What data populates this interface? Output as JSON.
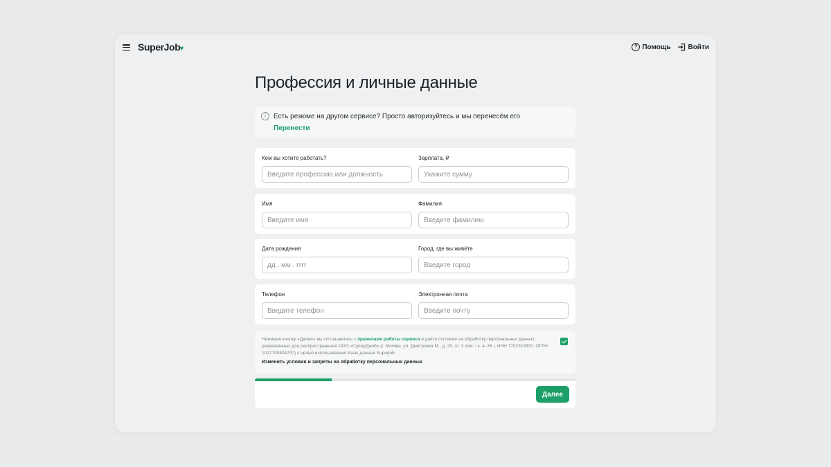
{
  "header": {
    "logo_text": "SuperJob",
    "help_label": "Помощь",
    "login_label": "Войти"
  },
  "page": {
    "title": "Профессия и личные данные"
  },
  "notice": {
    "message": "Есть резюме на другом сервисе? Просто авторизуйтесь и мы перенесём его",
    "link": "Перенести"
  },
  "form": {
    "profession": {
      "label": "Кем вы хотите работать?",
      "placeholder": "Введите профессию или должность",
      "value": ""
    },
    "salary": {
      "label": "Зарплата, ₽",
      "placeholder": "Укажите сумму",
      "value": ""
    },
    "first_name": {
      "label": "Имя",
      "placeholder": "Введите имя",
      "value": ""
    },
    "last_name": {
      "label": "Фамилия",
      "placeholder": "Введите фамилию",
      "value": ""
    },
    "birth_date": {
      "label": "Дата рождения",
      "placeholder": "дд . мм . гггг",
      "value": ""
    },
    "city": {
      "label": "Город, где вы живёте",
      "placeholder": "Введите город",
      "value": ""
    },
    "phone": {
      "label": "Телефон",
      "placeholder": "Введите телефон",
      "value": ""
    },
    "email": {
      "label": "Электронная почта",
      "placeholder": "Введите почту",
      "value": ""
    }
  },
  "consent": {
    "text_before": "Нажимая кнопку «Далее» вы соглашаетесь с ",
    "rules_link": "правилами работы сервиса",
    "text_after": " и даёте согласие на обработку персональных данных, разрешённых для распространения ООО «СуперДжоб» (г. Москва, ул. Дмитровка М., д. 20, эт. 3 пом. I к. 4–36 г, ИНН 7702319337, ОГРН 1027700404797) с целью использования Базы данных Superjob.",
    "change_link": "Изменить условия и запреты на обработку персональных данных",
    "checked": true
  },
  "progress": {
    "fraction": 0.24
  },
  "actions": {
    "next_label": "Далее"
  },
  "colors": {
    "accent": "#1c9f68",
    "background": "#e9ebec",
    "card": "#ffffff"
  }
}
